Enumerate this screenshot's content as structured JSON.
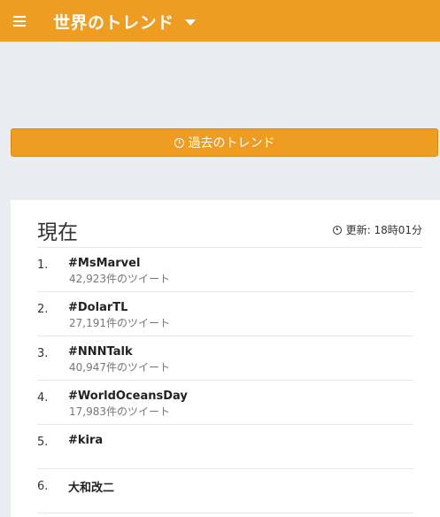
{
  "header": {
    "title": "世界のトレンド",
    "menu_icon": "hamburger-icon",
    "dropdown_icon": "caret-down-icon"
  },
  "past_button": {
    "label": "過去のトレンド",
    "icon": "clock-icon"
  },
  "trends": {
    "heading": "現在",
    "updated_label": "更新: 18時01分",
    "items": [
      {
        "rank": "1.",
        "name": "#MsMarvel",
        "count": "42,923件のツイート"
      },
      {
        "rank": "2.",
        "name": "#DolarTL",
        "count": "27,191件のツイート"
      },
      {
        "rank": "3.",
        "name": "#NNNTalk",
        "count": "40,947件のツイート"
      },
      {
        "rank": "4.",
        "name": "#WorldOceansDay",
        "count": "17,983件のツイート"
      },
      {
        "rank": "5.",
        "name": "#kira",
        "count": ""
      },
      {
        "rank": "6.",
        "name": "大和改二",
        "count": ""
      }
    ]
  },
  "colors": {
    "accent": "#ee9d22",
    "background": "#e9ecf0"
  }
}
